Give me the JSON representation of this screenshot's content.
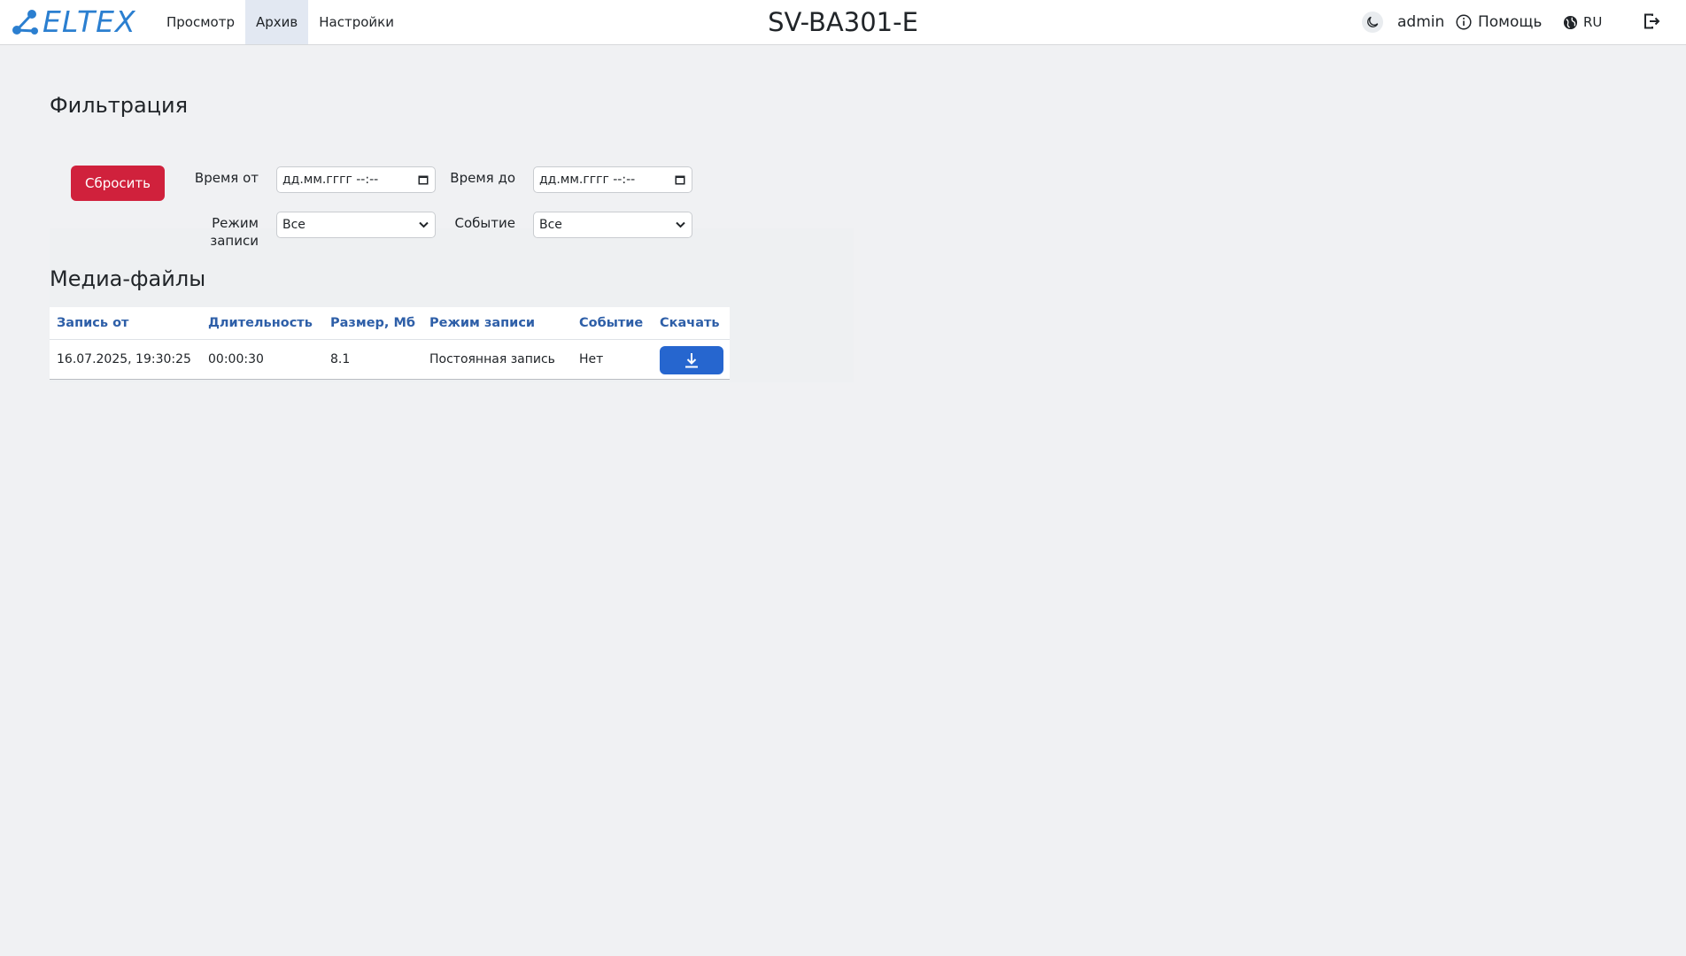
{
  "header": {
    "logo_text": "ELTEX",
    "nav": [
      {
        "label": "Просмотр",
        "active": false
      },
      {
        "label": "Архив",
        "active": true
      },
      {
        "label": "Настройки",
        "active": false
      }
    ],
    "device_title": "SV-BA301-E",
    "user": "admin",
    "help_label": "Помощь",
    "lang_label": "RU",
    "icons": [
      "theme-moon-icon",
      "info-icon",
      "globe-icon",
      "logout-icon"
    ]
  },
  "filter": {
    "title": "Фильтрация",
    "reset_label": "Сбросить",
    "time_from_label": "Время от",
    "time_to_label": "Время до",
    "time_from_value": "дд.мм.гггг --:--",
    "time_to_value": "дд.мм.гггг --:--",
    "mode_label_line1": "Режим",
    "mode_label_line2": "записи",
    "mode_value": "Все",
    "event_label": "Событие",
    "event_value": "Все"
  },
  "media": {
    "title": "Медиа-файлы",
    "columns": [
      "Запись от",
      "Длительность",
      "Размер, Мб",
      "Режим записи",
      "Событие",
      "Скачать"
    ],
    "rows": [
      {
        "start": "16.07.2025, 19:30:25",
        "duration": "00:00:30",
        "size": "8.1",
        "mode": "Постоянная запись",
        "event": "Нет"
      }
    ]
  },
  "colors": {
    "brand": "#2b7fd0",
    "reset_button": "#d0213c",
    "download_button": "#2666cf",
    "column_header": "#2e5fa8",
    "background": "#f0f1f3"
  }
}
